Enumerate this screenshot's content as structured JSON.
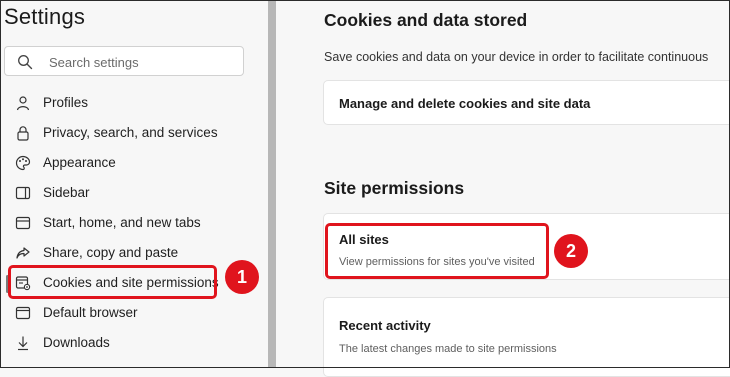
{
  "sidebar": {
    "title": "Settings",
    "search_placeholder": "Search settings",
    "items": [
      {
        "label": "Profiles",
        "icon": "profile-icon"
      },
      {
        "label": "Privacy, search, and services",
        "icon": "lock-icon"
      },
      {
        "label": "Appearance",
        "icon": "palette-icon"
      },
      {
        "label": "Sidebar",
        "icon": "sidebar-icon"
      },
      {
        "label": "Start, home, and new tabs",
        "icon": "home-tabs-icon"
      },
      {
        "label": "Share, copy and paste",
        "icon": "share-icon"
      },
      {
        "label": "Cookies and site permissions",
        "icon": "cookies-permissions-icon",
        "active": true
      },
      {
        "label": "Default browser",
        "icon": "browser-icon"
      },
      {
        "label": "Downloads",
        "icon": "download-icon"
      }
    ]
  },
  "main": {
    "cookies_heading": "Cookies and data stored",
    "cookies_description": "Save cookies and data on your device in order to facilitate continuous",
    "manage_card_label": "Manage and delete cookies and site data",
    "site_permissions_heading": "Site permissions",
    "all_sites": {
      "title": "All sites",
      "subtitle": "View permissions for sites you've visited"
    },
    "recent_activity": {
      "title": "Recent activity",
      "subtitle": "The latest changes made to site permissions"
    }
  },
  "annotations": {
    "step1": "1",
    "step2": "2",
    "highlight_color": "#e0141d"
  }
}
